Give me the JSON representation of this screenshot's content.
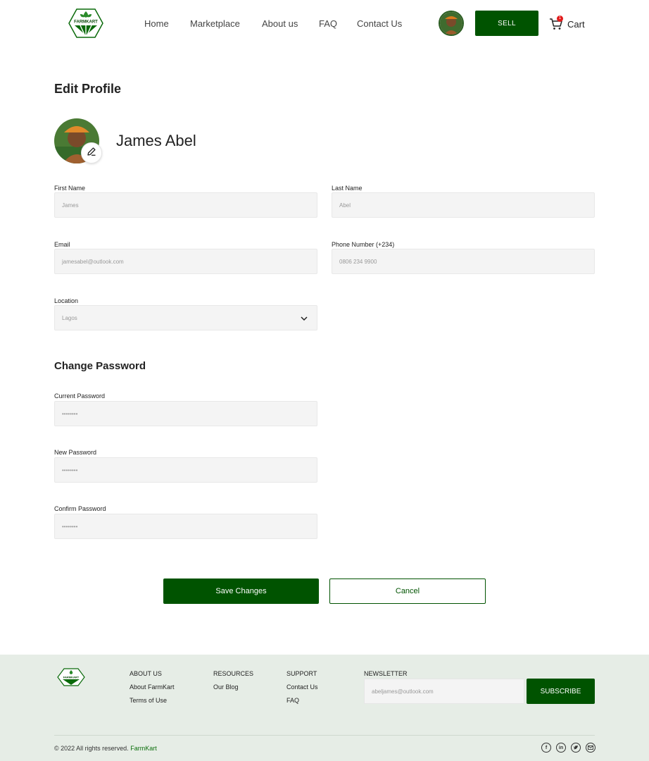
{
  "header": {
    "logo_text": "FARMKART",
    "nav": [
      "Home",
      "Marketplace",
      "About us",
      "FAQ",
      "Contact Us"
    ],
    "sell_label": "SELL",
    "cart_label": "Cart",
    "cart_count": "1"
  },
  "page": {
    "title": "Edit Profile",
    "user_name": "James Abel"
  },
  "form": {
    "first_name_label": "First Name",
    "first_name_value": "James",
    "last_name_label": "Last Name",
    "last_name_value": "Abel",
    "email_label": "Email",
    "email_value": "jamesabel@outlook.com",
    "phone_label": "Phone Number (+234)",
    "phone_value": "0806 234 9900",
    "location_label": "Location",
    "location_value": "Lagos"
  },
  "password": {
    "section_title": "Change Password",
    "current_label": "Current Password",
    "current_value": "••••••••",
    "new_label": "New Password",
    "new_value": "••••••••",
    "confirm_label": "Confirm Password",
    "confirm_value": "••••••••"
  },
  "actions": {
    "save_label": "Save Changes",
    "cancel_label": "Cancel"
  },
  "footer": {
    "logo_text": "FARMKART",
    "about_heading": "ABOUT US",
    "about_links": [
      "About FarmKart",
      "Terms of Use"
    ],
    "resources_heading": "RESOURCES",
    "resources_links": [
      "Our Blog"
    ],
    "support_heading": "SUPPORT",
    "support_links": [
      "Contact Us",
      "FAQ"
    ],
    "newsletter_heading": "NEWSLETTER",
    "newsletter_placeholder": "abeljames@outlook.com",
    "subscribe_label": "SUBSCRIBE",
    "copyright": "© 2022 All rights reserved.",
    "brand": "FarmKart",
    "social_icons": [
      "facebook-icon",
      "linkedin-icon",
      "twitter-icon",
      "mail-icon"
    ]
  },
  "colors": {
    "primary": "#005300",
    "footer_bg": "#e6ede6",
    "input_bg": "#f4f4f4",
    "badge": "#e21b1b"
  }
}
